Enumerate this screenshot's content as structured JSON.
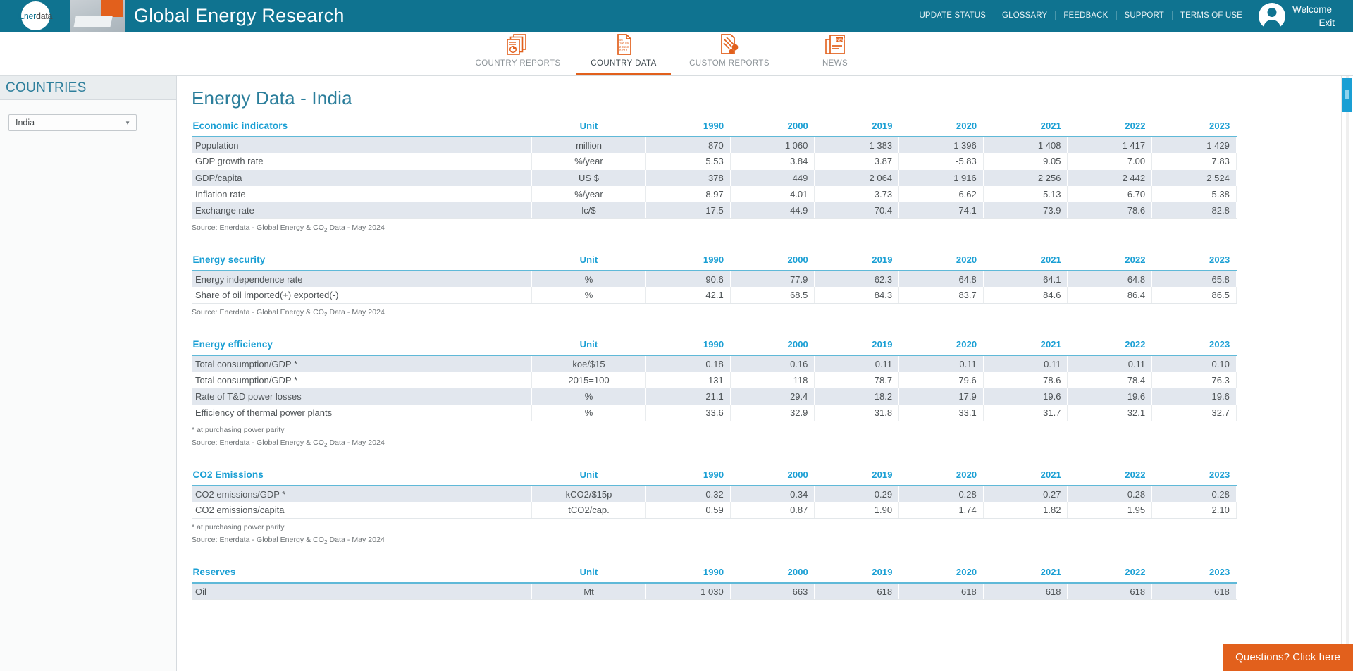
{
  "topbar": {
    "logo_ener": "Ener",
    "logo_data": "data",
    "title": "Global Energy Research",
    "links": [
      {
        "label": "UPDATE STATUS"
      },
      {
        "label": "GLOSSARY"
      },
      {
        "label": "FEEDBACK"
      },
      {
        "label": "SUPPORT"
      },
      {
        "label": "TERMS OF USE"
      }
    ],
    "welcome": "Welcome",
    "exit": "Exit",
    "bg_color": "#0f7390"
  },
  "mainnav": {
    "items": [
      {
        "label": "COUNTRY REPORTS",
        "icon": "stacked-documents-icon",
        "active": false
      },
      {
        "label": "COUNTRY DATA",
        "icon": "numbers-document-icon",
        "active": true
      },
      {
        "label": "CUSTOM REPORTS",
        "icon": "document-tools-icon",
        "active": false
      },
      {
        "label": "NEWS",
        "icon": "newspaper-icon",
        "active": false
      }
    ],
    "accent_color": "#e2601c"
  },
  "sidebar": {
    "header": "COUNTRIES",
    "country_select": {
      "value": "India",
      "caret": "chevron-down-icon"
    }
  },
  "main": {
    "page_title": "Energy Data - India",
    "source_note": "Source: Enerdata - Global Energy & CO2 Data - May 2024",
    "ppp_note": "* at purchasing power parity",
    "year_columns": [
      "1990",
      "2000",
      "2019",
      "2020",
      "2021",
      "2022",
      "2023"
    ],
    "unit_header": "Unit",
    "sections": [
      {
        "title": "Economic indicators",
        "has_ppp_note": false,
        "rows": [
          {
            "name": "Population",
            "unit": "million",
            "values": [
              "870",
              "1 060",
              "1 383",
              "1 396",
              "1 408",
              "1 417",
              "1 429"
            ]
          },
          {
            "name": "GDP growth rate",
            "unit": "%/year",
            "values": [
              "5.53",
              "3.84",
              "3.87",
              "-5.83",
              "9.05",
              "7.00",
              "7.83"
            ]
          },
          {
            "name": "GDP/capita",
            "unit": "US $",
            "values": [
              "378",
              "449",
              "2 064",
              "1 916",
              "2 256",
              "2 442",
              "2 524"
            ]
          },
          {
            "name": "Inflation rate",
            "unit": "%/year",
            "values": [
              "8.97",
              "4.01",
              "3.73",
              "6.62",
              "5.13",
              "6.70",
              "5.38"
            ]
          },
          {
            "name": "Exchange rate",
            "unit": "lc/$",
            "values": [
              "17.5",
              "44.9",
              "70.4",
              "74.1",
              "73.9",
              "78.6",
              "82.8"
            ]
          }
        ]
      },
      {
        "title": "Energy security",
        "has_ppp_note": false,
        "rows": [
          {
            "name": "Energy independence rate",
            "unit": "%",
            "values": [
              "90.6",
              "77.9",
              "62.3",
              "64.8",
              "64.1",
              "64.8",
              "65.8"
            ]
          },
          {
            "name": "Share of oil imported(+) exported(-)",
            "unit": "%",
            "values": [
              "42.1",
              "68.5",
              "84.3",
              "83.7",
              "84.6",
              "86.4",
              "86.5"
            ]
          }
        ]
      },
      {
        "title": "Energy efficiency",
        "has_ppp_note": true,
        "rows": [
          {
            "name": "Total consumption/GDP *",
            "unit": "koe/$15",
            "values": [
              "0.18",
              "0.16",
              "0.11",
              "0.11",
              "0.11",
              "0.11",
              "0.10"
            ]
          },
          {
            "name": "Total consumption/GDP *",
            "unit": "2015=100",
            "values": [
              "131",
              "118",
              "78.7",
              "79.6",
              "78.6",
              "78.4",
              "76.3"
            ]
          },
          {
            "name": "Rate of T&D power losses",
            "unit": "%",
            "values": [
              "21.1",
              "29.4",
              "18.2",
              "17.9",
              "19.6",
              "19.6",
              "19.6"
            ]
          },
          {
            "name": "Efficiency of thermal power plants",
            "unit": "%",
            "values": [
              "33.6",
              "32.9",
              "31.8",
              "33.1",
              "31.7",
              "32.1",
              "32.7"
            ]
          }
        ]
      },
      {
        "title": "CO2 Emissions",
        "has_ppp_note": true,
        "rows": [
          {
            "name": "CO2 emissions/GDP *",
            "unit": "kCO2/$15p",
            "values": [
              "0.32",
              "0.34",
              "0.29",
              "0.28",
              "0.27",
              "0.28",
              "0.28"
            ]
          },
          {
            "name": "CO2 emissions/capita",
            "unit": "tCO2/cap.",
            "values": [
              "0.59",
              "0.87",
              "1.90",
              "1.74",
              "1.82",
              "1.95",
              "2.10"
            ]
          }
        ]
      },
      {
        "title": "Reserves",
        "has_ppp_note": false,
        "rows": [
          {
            "name": "Oil",
            "unit": "Mt",
            "values": [
              "1 030",
              "663",
              "618",
              "618",
              "618",
              "618",
              "618"
            ]
          }
        ]
      }
    ]
  },
  "chat_widget": {
    "label": "Questions? Click here",
    "color": "#e2601c"
  }
}
